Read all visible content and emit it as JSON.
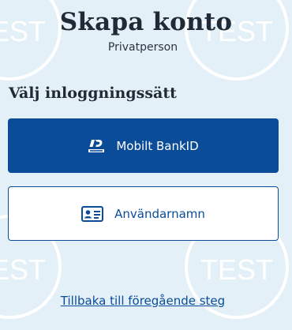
{
  "header": {
    "title": "Skapa konto",
    "subtitle": "Privatperson"
  },
  "login_section": {
    "heading": "Välj inloggningssätt",
    "bankid_button": {
      "label": "Mobilt BankID",
      "icon": "bankid-logo-icon"
    },
    "username_button": {
      "label": "Användarnamn",
      "icon": "id-card-icon"
    }
  },
  "back_link": {
    "label": "Tillbaka till föregående steg"
  },
  "watermark": {
    "text": "TEST"
  },
  "colors": {
    "background": "#e4f0f7",
    "primary": "#0a4c97",
    "text": "#1f2a36"
  }
}
